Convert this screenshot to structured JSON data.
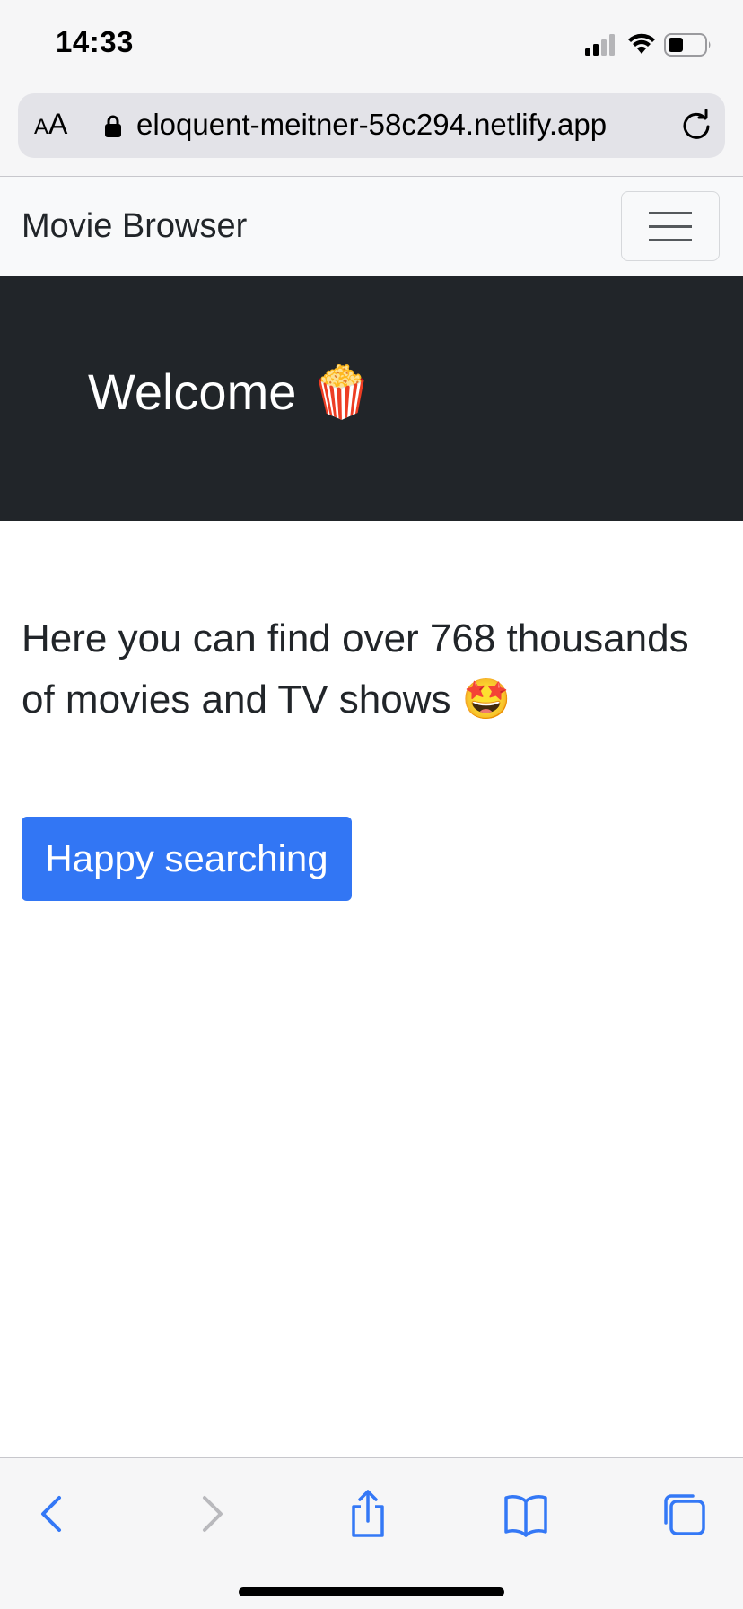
{
  "status_bar": {
    "time": "14:33"
  },
  "address_bar": {
    "reader_small": "A",
    "reader_large": "A",
    "url": "eloquent-meitner-58c294.netlify.app"
  },
  "navbar": {
    "brand": "Movie Browser"
  },
  "hero": {
    "title": "Welcome 🍿"
  },
  "main": {
    "intro": "Here you can find over 768 thousands of movies and TV shows 🤩",
    "button_label": "Happy searching"
  },
  "colors": {
    "hero_background": "#212529",
    "button_background": "#3276f4",
    "navbar_background": "#f8f9fa",
    "safari_tint": "#3478f6"
  },
  "toolbar": {
    "icons": [
      "back-icon",
      "forward-icon",
      "share-icon",
      "bookmarks-icon",
      "tabs-icon"
    ]
  }
}
